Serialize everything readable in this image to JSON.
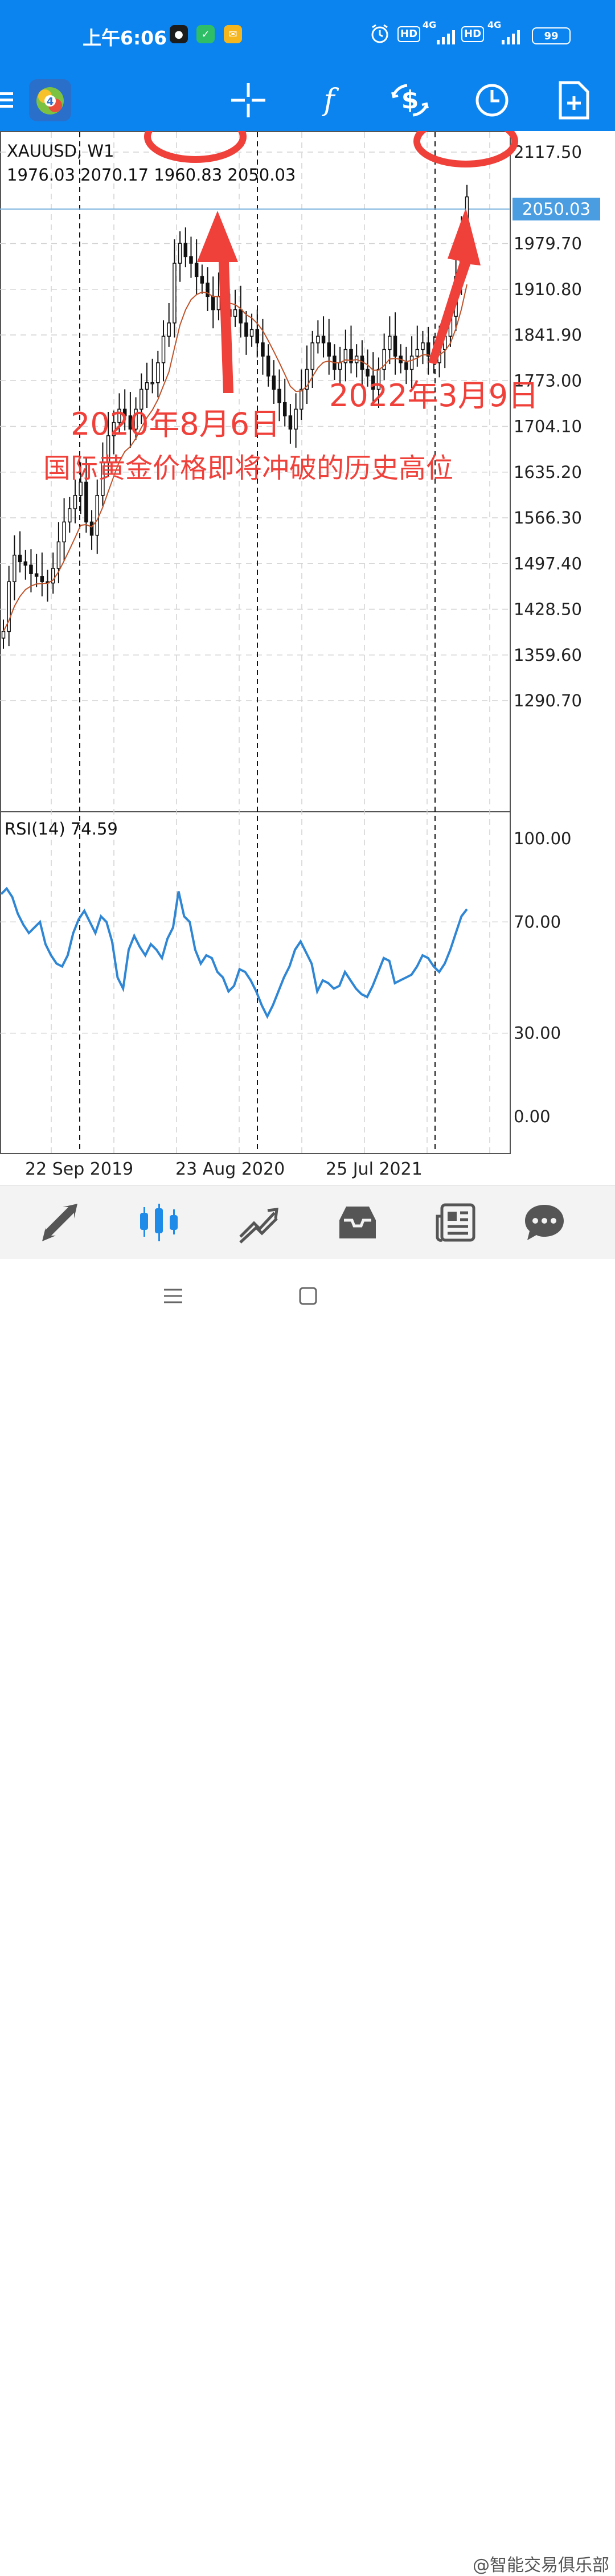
{
  "status_bar": {
    "time": "上午6:06",
    "network_1": "4G",
    "network_2": "4G",
    "hd_1": "HD",
    "hd_2": "HD",
    "battery": "99"
  },
  "toolbar": {
    "icons": [
      "menu-icon",
      "mt4-app-icon",
      "crosshair-icon",
      "indicators-icon",
      "trade-icon",
      "timeframe-icon",
      "add-object-icon"
    ],
    "indicators_glyph": "f"
  },
  "chart": {
    "symbol": "XAUUSD, W1",
    "ohlc": "1976.03 2070.17 1960.83 2050.03",
    "current_price": "2050.03",
    "price_ticks": [
      "2117.50",
      "2050.03",
      "1979.70",
      "1910.80",
      "1841.90",
      "1773.00",
      "1704.10",
      "1635.20",
      "1566.30",
      "1497.40",
      "1428.50",
      "1359.60",
      "1290.70"
    ],
    "date_labels": [
      "22 Sep 2019",
      "23 Aug 2020",
      "25 Jul 2021"
    ],
    "rsi_label": "RSI(14) 74.59",
    "rsi_ticks": [
      "100.00",
      "70.00",
      "30.00",
      "0.00"
    ]
  },
  "chart_data": {
    "type": "candlestick",
    "title": "XAUUSD, W1",
    "last_bar": {
      "open": 1976.03,
      "high": 2070.17,
      "low": 1960.83,
      "close": 2050.03
    },
    "ylim": [
      1290.7,
      2117.5
    ],
    "indicator": {
      "name": "RSI(14)",
      "value": 74.59,
      "ylim": [
        0,
        100
      ],
      "levels": [
        30,
        70
      ]
    },
    "x_labels": [
      "22 Sep 2019",
      "23 Aug 2020",
      "25 Jul 2021"
    ],
    "close_path": [
      1395,
      1470,
      1510,
      1500,
      1495,
      1482,
      1478,
      1470,
      1468,
      1490,
      1530,
      1560,
      1580,
      1600,
      1620,
      1560,
      1540,
      1600,
      1650,
      1690,
      1710,
      1730,
      1720,
      1700,
      1730,
      1760,
      1770,
      1770,
      1800,
      1840,
      1860,
      1950,
      1980,
      1960,
      1950,
      1930,
      1920,
      1900,
      1880,
      1900,
      1880,
      1870,
      1880,
      1860,
      1840,
      1850,
      1830,
      1810,
      1780,
      1760,
      1740,
      1720,
      1700,
      1730,
      1760,
      1790,
      1830,
      1840,
      1830,
      1810,
      1790,
      1800,
      1820,
      1800,
      1810,
      1790,
      1780,
      1760,
      1790,
      1820,
      1840,
      1810,
      1800,
      1790,
      1810,
      1820,
      1830,
      1810,
      1800,
      1820,
      1840,
      1870,
      1930,
      1985,
      2050.03
    ],
    "rsi_path": [
      80,
      82,
      79,
      73,
      69,
      66,
      68,
      70,
      62,
      58,
      55,
      54,
      58,
      66,
      71,
      74,
      70,
      66,
      72,
      70,
      63,
      50,
      46,
      60,
      65,
      61,
      58,
      62,
      60,
      57,
      64,
      68,
      81,
      72,
      70,
      60,
      55,
      58,
      57,
      52,
      50,
      45,
      47,
      53,
      52,
      49,
      45,
      40,
      36,
      40,
      45,
      50,
      54,
      60,
      63,
      59,
      55,
      45,
      49,
      48,
      46,
      47,
      52,
      49,
      46,
      44,
      43,
      47,
      52,
      57,
      56,
      48,
      49,
      50,
      51,
      54,
      58,
      57,
      54,
      52,
      55,
      60,
      66,
      72,
      74.59
    ]
  },
  "annotations": {
    "date1": "2020年8月6日",
    "date2": "2022年3月9日",
    "caption": "国际黄金价格即将冲破的历史高位"
  },
  "bottom_nav": {
    "items": [
      "quotes-icon",
      "chart-icon",
      "trade-icon",
      "history-icon",
      "news-icon",
      "messages-icon"
    ],
    "active": "chart-icon"
  },
  "system_nav": {
    "watermark": "@智能交易俱乐部"
  },
  "colors": {
    "bar_blue": "#0b84f0",
    "annotation_red": "#f0403a",
    "rsi_line": "#2f86d4",
    "ma_line": "#c0532a",
    "price_line": "#7fb6df"
  }
}
